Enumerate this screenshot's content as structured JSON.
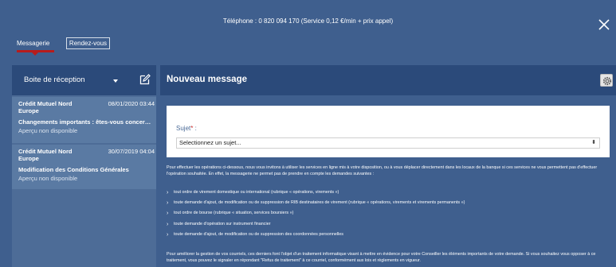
{
  "header": {
    "phone_text": "Téléphone : 0 820 094 170 (Service 0,12 €/min + prix appel)",
    "tabs": [
      {
        "label": "Messagerie",
        "active": true
      },
      {
        "label": "Rendez-vous",
        "active": false
      }
    ],
    "close_icon": "close-icon"
  },
  "sidebar": {
    "title": "Boite de réception",
    "messages": [
      {
        "sender": "Crédit Mutuel Nord Europe",
        "date": "08/01/2020 03:44",
        "subject": "Changements importants : êtes-vous concerné ?",
        "preview": "Aperçu non disponible"
      },
      {
        "sender": "Crédit Mutuel Nord Europe",
        "date": "30/07/2019 04:04",
        "subject": "Modification des Conditions Générales",
        "preview": "Aperçu non disponible"
      }
    ]
  },
  "main": {
    "title": "Nouveau message",
    "subject_label": "Sujet",
    "subject_required_mark": "*",
    "subject_colon": ":",
    "subject_value": "Selectionnez un sujet...",
    "intro": "Pour effectuer les opérations ci-dessous, nous vous invitons à utiliser les services en ligne mis à votre disposition, ou à vous déplacer directement dans les locaux de la banque si ces services ne vous permettent pas d'effectuer l'opération souhaitée. En effet, la messagerie ne permet pas de prendre en compte les demandes suivantes :",
    "bullets": [
      "tout ordre de virement domestique ou international (rubrique « opérations, virements »)",
      "toute demande d'ajout, de modification ou de suppression de RIB destinataires de virement (rubrique « opérations, virements et virements permanents »)",
      "tout ordre de bourse (rubrique « situation, services boursiers »)",
      "toute demande d'opération sur instrument financier",
      "toute demande d'ajout, de modification ou de suppression des coordonnées personnelles"
    ],
    "outro": "Pour améliorer la gestion de vos courriels, ces derniers font l'objet d'un traitement informatique visant à mettre en évidence pour votre Conseiller les éléments importants de votre demande. Si vous souhaitez vous opposer à ce traitement, vous pouvez le signaler en répondant \"Refus de traitement\" à ce courriel, conformément aux lois et règlements en vigueur."
  },
  "colors": {
    "background": "#3f5f8e",
    "header_dark": "#2b4a7a",
    "accent_red": "#b71c1c"
  }
}
